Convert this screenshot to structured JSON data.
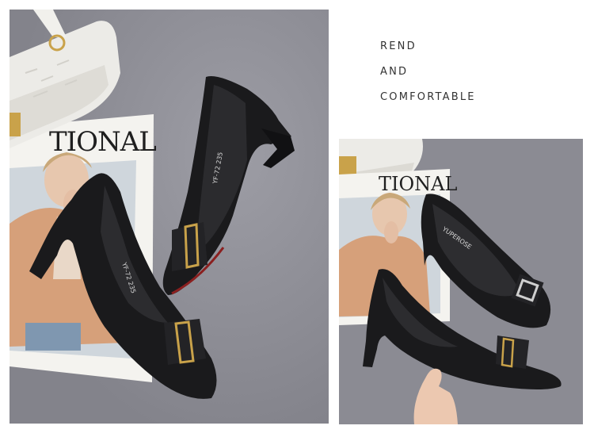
{
  "tagline": {
    "line1": "REND",
    "line2": "AND",
    "line3": "COMFORTABLE"
  },
  "photos": {
    "left": {
      "magazine_title": "TIONAL",
      "insole_text_1": "YF-72  235",
      "insole_text_2": "YF-72  235"
    },
    "right": {
      "magazine_title": "TIONAL",
      "insole_brand": "YUPEROSE"
    }
  },
  "colors": {
    "background": "#8c8c94",
    "shoe_leather": "#1a1a1c",
    "bag": "#ecebe7",
    "gold_hardware": "#c9a24a"
  }
}
